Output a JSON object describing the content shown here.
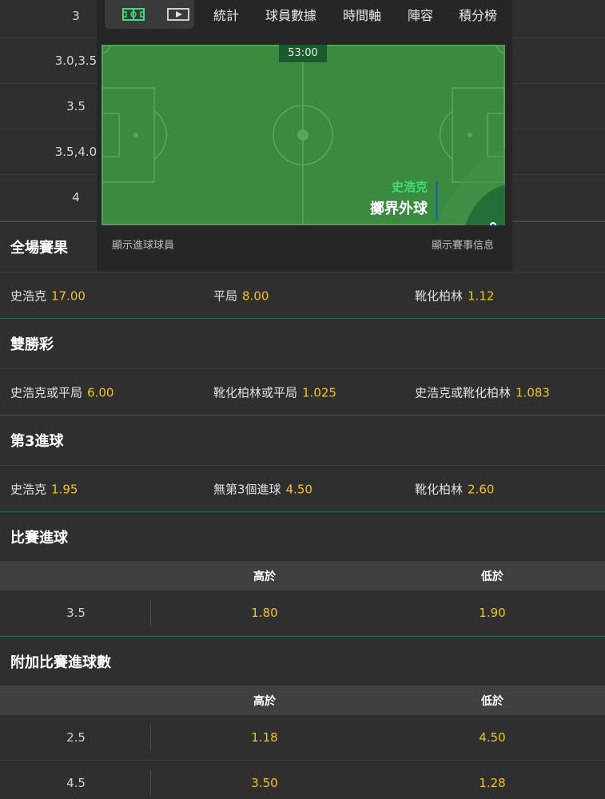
{
  "top_lines": [
    "3",
    "3.0,3.5",
    "3.5",
    "3.5,4.0",
    "4"
  ],
  "widget": {
    "tabs": [
      "統計",
      "球員數據",
      "時間軸",
      "陣容",
      "積分榜"
    ],
    "clock": "53:00",
    "event_team": "史浩克",
    "event_text": "擲界外球",
    "footer_left": "顯示進球球員",
    "footer_right": "顯示賽事信息"
  },
  "markets": {
    "full_time": {
      "title": "全場賽果",
      "selections": [
        {
          "name": "史浩克",
          "odds": "17.00"
        },
        {
          "name": "平局",
          "odds": "8.00"
        },
        {
          "name": "靴化柏林",
          "odds": "1.12"
        }
      ]
    },
    "double_chance": {
      "title": "雙勝彩",
      "selections": [
        {
          "name": "史浩克或平局",
          "odds": "6.00"
        },
        {
          "name": "靴化柏林或平局",
          "odds": "1.025"
        },
        {
          "name": "史浩克或靴化柏林",
          "odds": "1.083"
        }
      ]
    },
    "third_goal": {
      "title": "第3進球",
      "selections": [
        {
          "name": "史浩克",
          "odds": "1.95"
        },
        {
          "name": "無第3個進球",
          "odds": "4.50"
        },
        {
          "name": "靴化柏林",
          "odds": "2.60"
        }
      ]
    },
    "match_goals": {
      "title": "比賽進球",
      "over_label": "高於",
      "under_label": "低於",
      "rows": [
        {
          "line": "3.5",
          "over": "1.80",
          "under": "1.90"
        }
      ]
    },
    "extra_goals": {
      "title": "附加比賽進球數",
      "over_label": "高於",
      "under_label": "低於",
      "rows": [
        {
          "line": "2.5",
          "over": "1.18",
          "under": "4.50"
        },
        {
          "line": "4.5",
          "over": "3.50",
          "under": "1.28"
        }
      ]
    }
  },
  "colors": {
    "odds": "#f5c518",
    "pitch": "#3a8a3f",
    "accent_green": "#3be07a",
    "event_bar": "#1565c0"
  },
  "icons": [
    "pitch-view-icon",
    "video-play-icon"
  ]
}
